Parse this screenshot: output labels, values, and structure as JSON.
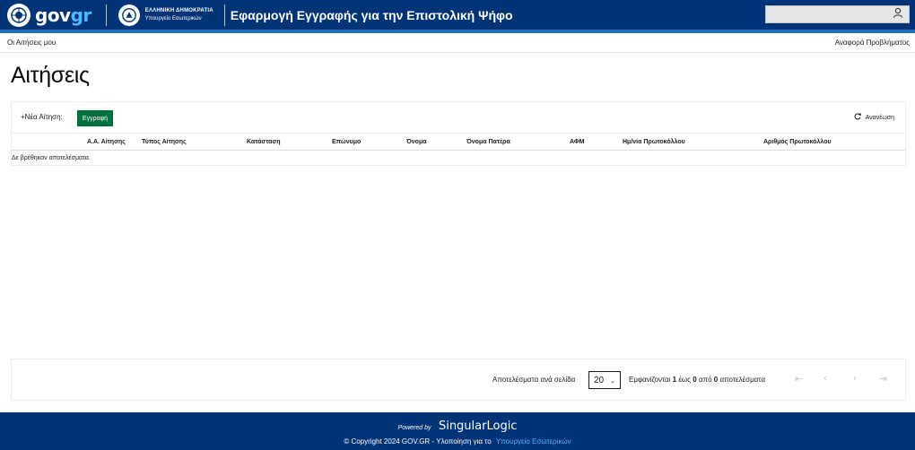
{
  "header": {
    "logo_gov": "gov",
    "logo_gr": "gr",
    "ministry_line1": "ΕΛΛΗΝΙΚΗ ΔΗΜΟΚΡΑΤΙΑ",
    "ministry_line2": "Υπουργείο Εσωτερικών",
    "app_title": "Εφαρμογή Εγγραφής για την Επιστολική Ψήφο",
    "user_icon": "user-icon",
    "colors": {
      "bar": "#003476",
      "accent": "#1c6fbf",
      "gr": "#4fb8ff"
    }
  },
  "subnav": {
    "my_applications": "Οι Αιτήσεις μου",
    "report_problems": "Αναφορά Προβλήματος"
  },
  "page": {
    "title": "Αιτήσεις"
  },
  "grid": {
    "new_application": "Νέα Αίτηση:",
    "register_button": "Εγγραφή",
    "register_color": "#00703c",
    "refresh": "Ανανέωση",
    "columns": [
      "Α.Α. Αίτησης",
      "Τύπος Αίτησης",
      "Κατάσταση",
      "Επώνυμο",
      "Όνομα",
      "Όνομα Πατέρα",
      "ΑΦΜ",
      "Ημ/νία Πρωτοκόλλου",
      "Αριθμός Πρωτοκόλλου"
    ],
    "empty_message": "Δε βρέθηκαν αποτελέσματα."
  },
  "pager": {
    "results_per_page_label": "Αποτελέσματα ανά σελίδα",
    "page_size": "20",
    "shown_prefix": "Εμφανίζονται",
    "from": "1",
    "to_word": "έως",
    "to": "0",
    "of_word": "από",
    "total": "0",
    "results_word": "αποτελέσματα"
  },
  "footer": {
    "powered_by": "Powered by",
    "brand": "SingularLogic",
    "copyright": "© Copyright 2024 GOV.GR - Υλοποίηση για το",
    "ministry_link": "Υπουργείο Εσωτερικών"
  }
}
